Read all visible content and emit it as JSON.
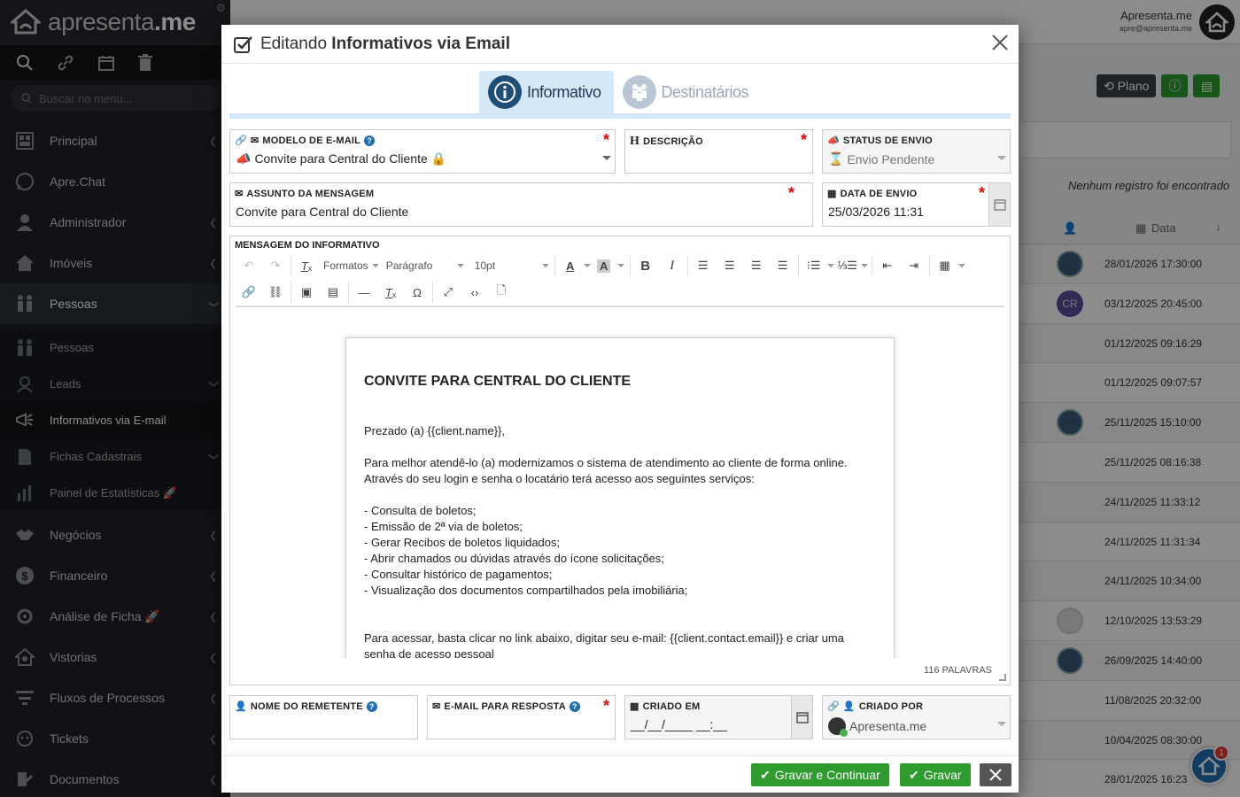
{
  "sidebar": {
    "logo_text": "apresenta",
    "logo_suffix": ".me",
    "search_placeholder": "Buscar no menu...",
    "items": [
      {
        "label": "Principal",
        "icon": "dashboard-icon"
      },
      {
        "label": "Apre.Chat",
        "icon": "whatsapp-icon"
      },
      {
        "label": "Administrador",
        "icon": "user-admin-icon"
      },
      {
        "label": "Imóveis",
        "icon": "home-icon"
      },
      {
        "label": "Pessoas",
        "icon": "people-icon"
      }
    ],
    "sub_items": [
      {
        "label": "Pessoas",
        "icon": "people-icon"
      },
      {
        "label": "Leads",
        "icon": "leads-icon"
      },
      {
        "label": "Informativos via E-mail",
        "icon": "bullhorn-icon"
      },
      {
        "label": "Fichas Cadastrais",
        "icon": "file-icon"
      },
      {
        "label": "Painel de Estatísticas 🚀",
        "icon": "chart-icon"
      }
    ],
    "items_bottom": [
      {
        "label": "Negócios",
        "icon": "handshake-icon"
      },
      {
        "label": "Financeiro",
        "icon": "dollar-icon"
      },
      {
        "label": "Análise de Ficha 🚀",
        "icon": "analysis-icon"
      },
      {
        "label": "Vistorias",
        "icon": "inspection-icon"
      },
      {
        "label": "Fluxos de Processos",
        "icon": "flow-icon"
      },
      {
        "label": "Tickets",
        "icon": "ticket-icon"
      },
      {
        "label": "Documentos",
        "icon": "document-icon"
      }
    ]
  },
  "topbar": {
    "user_name": "Apresenta.me",
    "user_email": "apre@apresenta.me"
  },
  "background": {
    "plan_label": "Plano",
    "no_records": "Nenhum registro foi encontrado",
    "date_header": "Data",
    "rows": [
      {
        "date": "28/01/2026 17:30:00",
        "avatar": "photo"
      },
      {
        "date": "03/12/2025 20:45:00",
        "avatar": "CR"
      },
      {
        "date": "01/12/2025 09:16:29",
        "avatar": ""
      },
      {
        "date": "01/12/2025 09:07:57",
        "avatar": ""
      },
      {
        "date": "25/11/2025 15:10:00",
        "avatar": "photo"
      },
      {
        "date": "25/11/2025 08:16:38",
        "avatar": ""
      },
      {
        "date": "24/11/2025 11:33:12",
        "avatar": ""
      },
      {
        "date": "24/11/2025 11:31:34",
        "avatar": ""
      },
      {
        "date": "24/11/2025 10:34:00",
        "avatar": ""
      },
      {
        "date": "12/10/2025 13:53:29",
        "avatar": "robot"
      },
      {
        "date": "26/09/2025 14:40:00",
        "avatar": "photo"
      },
      {
        "date": "11/08/2025 20:32:00",
        "avatar": ""
      },
      {
        "date": "10/04/2025 08:30:00",
        "avatar": ""
      },
      {
        "date": "28/01/2025 16:23",
        "avatar": ""
      }
    ],
    "chat_badge": "1"
  },
  "modal": {
    "title_prefix": "Editando",
    "title_bold": "Informativos via Email",
    "tabs": [
      {
        "label": "Informativo",
        "active": true
      },
      {
        "label": "Destinatários",
        "active": false
      }
    ],
    "fields": {
      "modelo_label": "MODELO DE E-MAIL",
      "modelo_value": "Convite para Central do Cliente 🔒",
      "descricao_label": "DESCRIÇÃO",
      "descricao_value": "",
      "status_label": "STATUS DE ENVIO",
      "status_value": "Envio Pendente",
      "assunto_label": "ASSUNTO DA MENSAGEM",
      "assunto_value": "Convite para Central do Cliente",
      "data_label": "DATA DE ENVIO",
      "data_value": "25/03/2026 11:31",
      "mensagem_label": "MENSAGEM DO INFORMATIVO",
      "remetente_label": "NOME DO REMETENTE",
      "resposta_label": "E-MAIL PARA RESPOSTA",
      "criado_em_label": "CRIADO EM",
      "criado_em_placeholder": "__/__/____ __:__",
      "criado_por_label": "CRIADO POR",
      "criado_por_value": "Apresenta.me"
    },
    "toolbar": {
      "formatos": "Formatos",
      "paragrafo": "Parágrafo",
      "font_size": "10pt"
    },
    "content": {
      "heading": "CONVITE PARA CENTRAL DO CLIENTE",
      "greeting": "Prezado (a) {{client.name}},",
      "intro_1": "Para melhor atendê-lo (a) modernizamos o sistema de atendimento ao cliente de forma online.",
      "intro_2": "Através do seu login e senha o locatário terá acesso aos seguintes serviços:",
      "list": [
        "- Consulta de boletos;",
        "- Emissão de 2ª via de boletos;",
        "- Gerar Recibos de boletos liquidados;",
        "- Abrir chamados ou dúvidas através do ícone solicitações;",
        "- Consultar histórico de pagamentos;",
        "- Visualização dos documentos compartilhados pela imobiliária;"
      ],
      "access_1": "Para acessar, basta clicar no link abaixo, digitar seu e-mail: {{client.contact.email}} e criar uma",
      "access_2": "senha de acesso pessoal"
    },
    "word_count": "116 PALAVRAS",
    "buttons": {
      "save_continue": "Gravar e Continuar",
      "save": "Gravar"
    }
  },
  "colors": {
    "sidebar_bg": "#1e2227",
    "accent_blue": "#1f4e79",
    "green": "#2d9b2d",
    "required": "#e00000"
  }
}
